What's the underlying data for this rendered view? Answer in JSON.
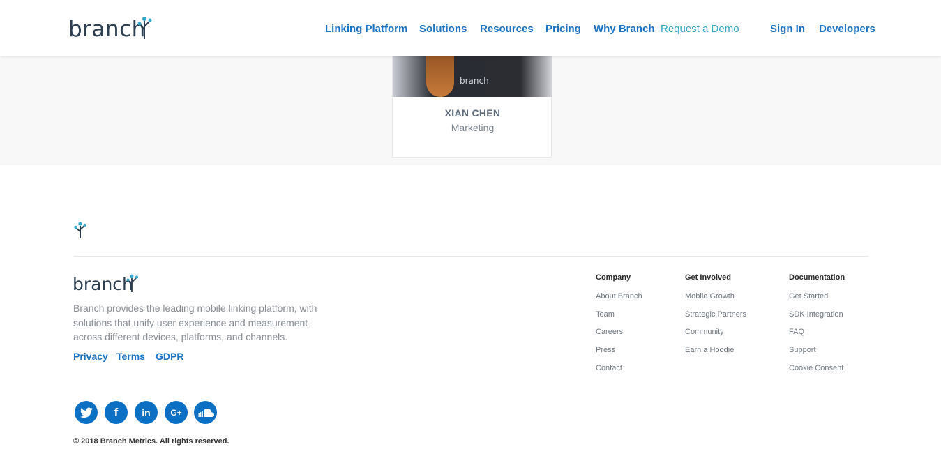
{
  "header": {
    "logo_text": "branch",
    "nav": [
      {
        "label": "Linking Platform"
      },
      {
        "label": "Solutions"
      },
      {
        "label": "Resources"
      },
      {
        "label": "Pricing"
      },
      {
        "label": "Why Branch"
      },
      {
        "label": "Request a Demo"
      },
      {
        "label": "Sign In"
      },
      {
        "label": "Developers"
      }
    ]
  },
  "team_card": {
    "shirt_text": "branch",
    "name": "XIAN CHEN",
    "role": "Marketing"
  },
  "footer": {
    "logo_text": "branch",
    "description": "Branch provides the leading mobile linking platform, with solutions that unify user experience and measurement across different devices, platforms, and channels.",
    "legal_links": [
      "Privacy",
      "Terms",
      "GDPR"
    ],
    "columns": [
      {
        "heading": "Company",
        "links": [
          "About Branch",
          "Team",
          "Careers",
          "Press",
          "Contact"
        ]
      },
      {
        "heading": "Get Involved",
        "links": [
          "Mobile Growth",
          "Strategic Partners",
          "Community",
          "Earn a Hoodie"
        ]
      },
      {
        "heading": "Documentation",
        "links": [
          "Get Started",
          "SDK Integration",
          "FAQ",
          "Support",
          "Cookie Consent"
        ]
      }
    ],
    "social": [
      {
        "icon": "twitter-icon"
      },
      {
        "icon": "facebook-icon",
        "glyph": "f"
      },
      {
        "icon": "linkedin-icon",
        "glyph": "in"
      },
      {
        "icon": "google-plus-icon",
        "glyph": "G+"
      },
      {
        "icon": "soundcloud-icon"
      }
    ],
    "copyright": "© 2018 Branch Metrics. All rights reserved."
  },
  "colors": {
    "brand_blue": "#1a73c5",
    "demo_teal": "#35a7c9",
    "social_blue": "#0b6fc4",
    "band_grey": "#f8f8f8"
  }
}
